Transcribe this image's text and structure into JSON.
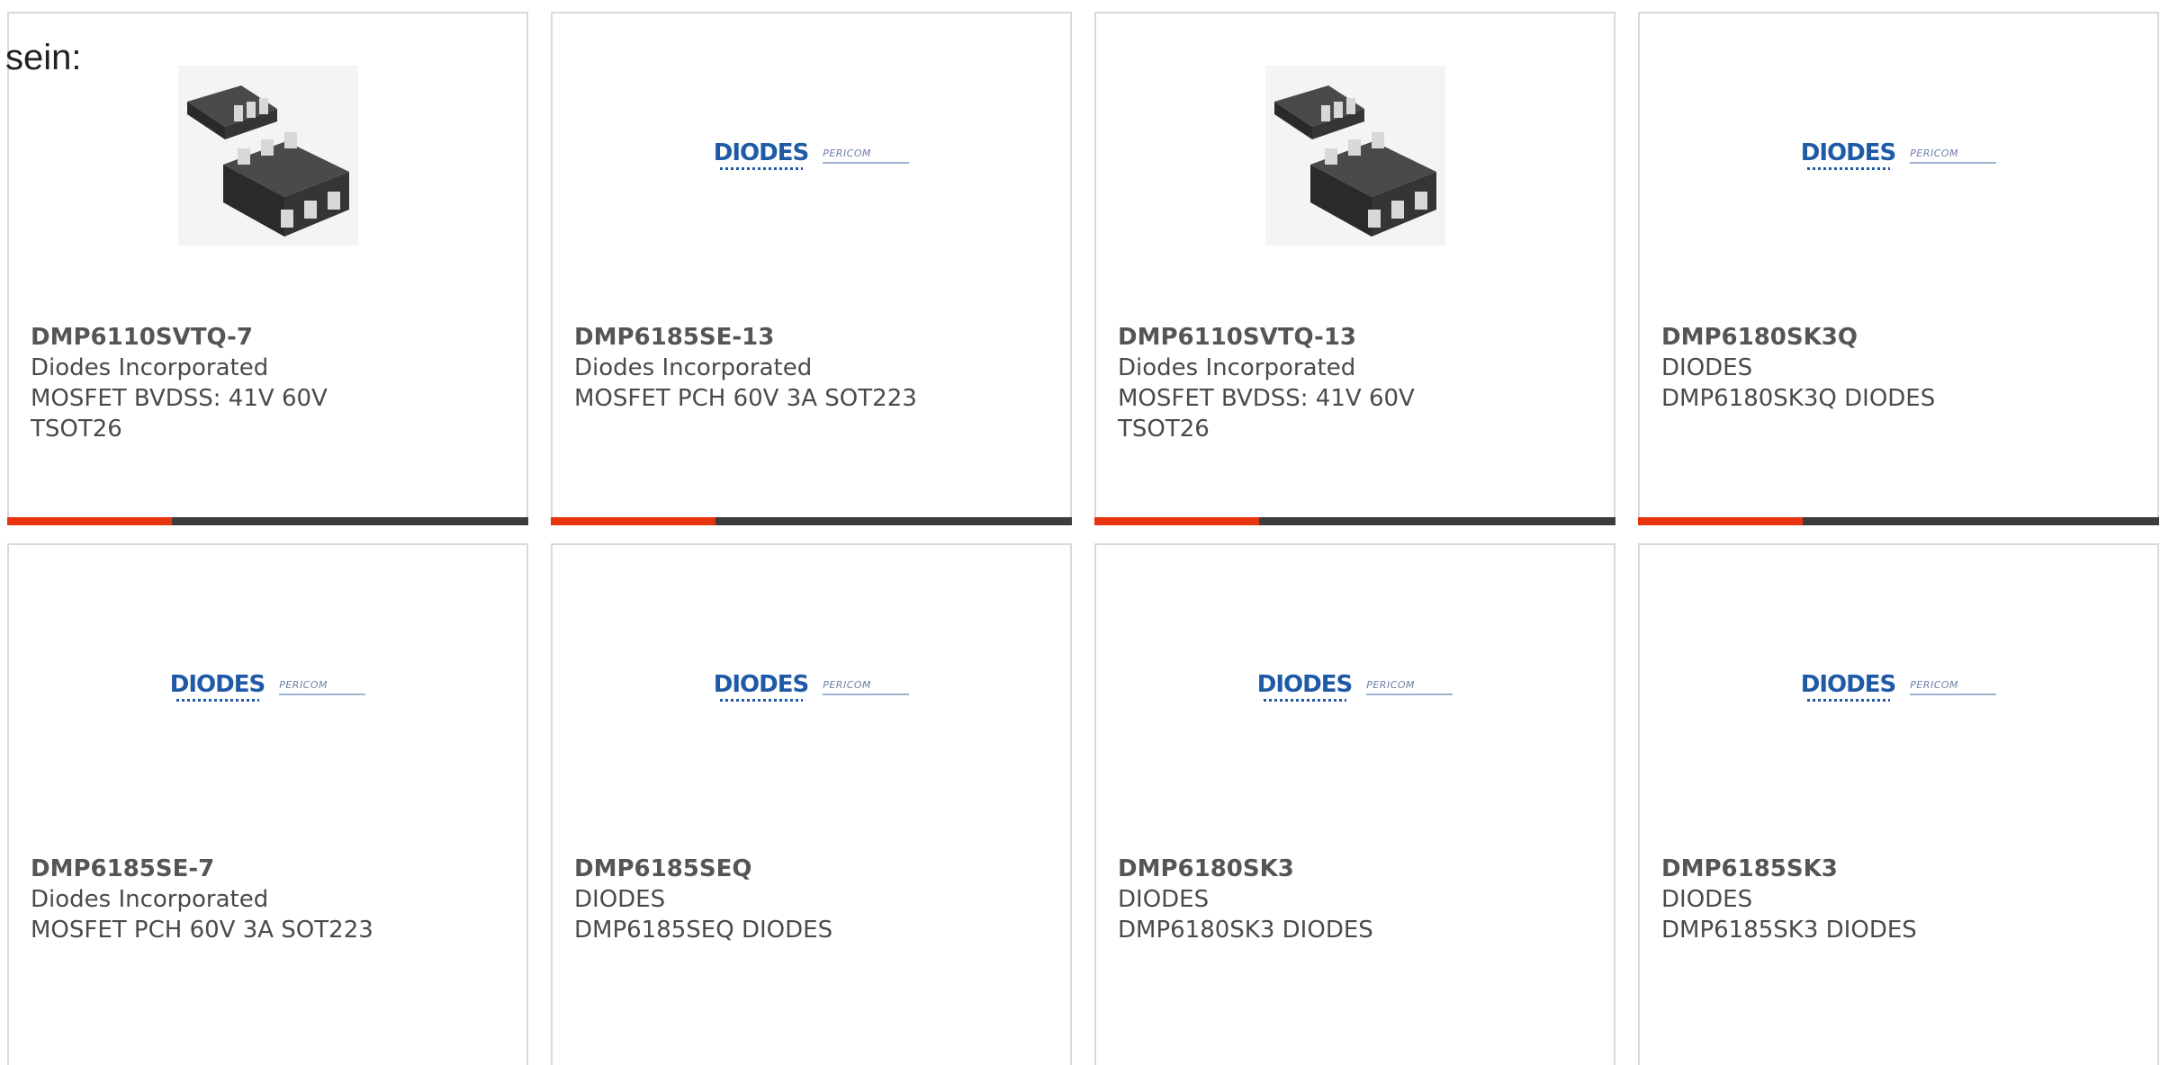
{
  "heading": "sein:",
  "colors": {
    "accent": "#e8340e",
    "bar": "#3c3c3c",
    "logo_blue": "#1f5aa6"
  },
  "logo": {
    "brand": "DIODES",
    "partner": "PERICOM"
  },
  "products": [
    {
      "part": "DMP6110SVTQ-7",
      "maker": "Diodes Incorporated",
      "desc_lines": [
        "MOSFET BVDSS: 41V 60V",
        "TSOT26"
      ],
      "image": "tsot26-chip-icon"
    },
    {
      "part": "DMP6185SE-13",
      "maker": "Diodes Incorporated",
      "desc_lines": [
        "MOSFET PCH 60V 3A SOT223",
        ""
      ],
      "image": "diodes-logo"
    },
    {
      "part": "DMP6110SVTQ-13",
      "maker": "Diodes Incorporated",
      "desc_lines": [
        "MOSFET BVDSS: 41V 60V",
        "TSOT26"
      ],
      "image": "tsot26-chip-icon"
    },
    {
      "part": "DMP6180SK3Q",
      "maker": "DIODES",
      "desc_lines": [
        "DMP6180SK3Q DIODES",
        ""
      ],
      "image": "diodes-logo"
    },
    {
      "part": "DMP6185SE-7",
      "maker": "Diodes Incorporated",
      "desc_lines": [
        "MOSFET PCH 60V 3A SOT223",
        ""
      ],
      "image": "diodes-logo"
    },
    {
      "part": "DMP6185SEQ",
      "maker": "DIODES",
      "desc_lines": [
        "DMP6185SEQ DIODES",
        ""
      ],
      "image": "diodes-logo"
    },
    {
      "part": "DMP6180SK3",
      "maker": "DIODES",
      "desc_lines": [
        "DMP6180SK3 DIODES",
        ""
      ],
      "image": "diodes-logo"
    },
    {
      "part": "DMP6185SK3",
      "maker": "DIODES",
      "desc_lines": [
        "DMP6185SK3 DIODES",
        ""
      ],
      "image": "diodes-logo"
    }
  ]
}
